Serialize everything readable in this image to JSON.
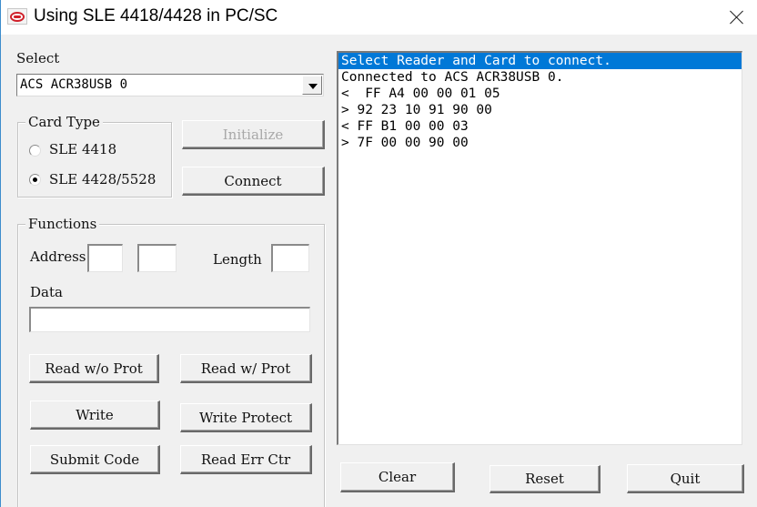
{
  "window": {
    "title": "Using SLE 4418/4428 in PC/SC",
    "icon": "acs-logo-icon",
    "close_icon": "close-icon"
  },
  "reader": {
    "label": "Select",
    "selected": "ACS ACR38USB 0"
  },
  "card_type": {
    "title": "Card Type",
    "options": [
      {
        "label": "SLE 4418",
        "checked": false
      },
      {
        "label": "SLE 4428/5528",
        "checked": true
      }
    ]
  },
  "buttons": {
    "initialize": "Initialize",
    "connect": "Connect",
    "read_wo_prot": "Read w/o Prot",
    "read_w_prot": "Read w/ Prot",
    "write": "Write",
    "write_protect": "Write Protect",
    "submit_code": "Submit Code",
    "read_err_ctr": "Read Err Ctr",
    "clear": "Clear",
    "reset": "Reset",
    "quit": "Quit"
  },
  "functions": {
    "title": "Functions",
    "address_label": "Address:",
    "address_hi": "",
    "address_lo": "",
    "length_label": "Length",
    "length": "",
    "data_label": "Data",
    "data": ""
  },
  "log": {
    "selected_index": 0,
    "lines": [
      "Select Reader and Card to connect.",
      "Connected to ACS ACR38USB 0.",
      "<  FF A4 00 00 01 05",
      "> 92 23 10 91 90 00",
      "< FF B1 00 00 03",
      "> 7F 00 00 90 00"
    ]
  }
}
